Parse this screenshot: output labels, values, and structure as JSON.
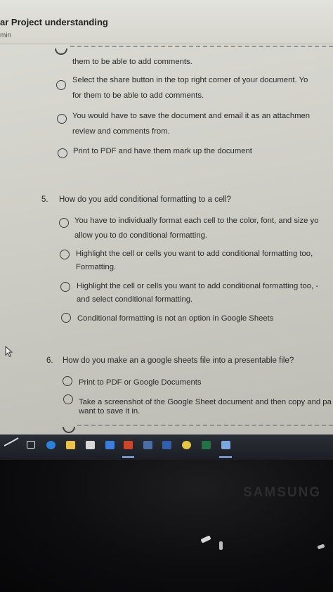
{
  "header": {
    "title": "ar Project understanding",
    "time": "min"
  },
  "question4": {
    "options": [
      {
        "line1": "them to be able to add comments.",
        "line2": ""
      },
      {
        "line1": "Select the share button in the top right corner of your document. Yo",
        "line2": "for them to be able to add comments."
      },
      {
        "line1": "You would have to save the document and email it as an attachmen",
        "line2": "review and comments from."
      },
      {
        "line1": "Print to PDF and have them mark up the document",
        "line2": ""
      }
    ]
  },
  "question5": {
    "number": "5.",
    "text": "How do you add conditional formatting to a cell?",
    "options": [
      {
        "line1": "You have to individually format each cell to the color, font, and size yo",
        "line2": "allow you to do conditional formatting."
      },
      {
        "line1": "Highlight the cell or cells you want to add conditional formatting too,",
        "line2": "Formatting."
      },
      {
        "line1": "Highlight the cell or cells you want to add conditional formatting too, -",
        "line2": "and select conditional formatting."
      },
      {
        "line1": "Conditional formatting is not an option in Google Sheets",
        "line2": ""
      }
    ]
  },
  "question6": {
    "number": "6.",
    "text": "How do you make an a google sheets file into a presentable file?",
    "options": [
      {
        "line1": "Print to PDF or Google Documents",
        "line2": ""
      },
      {
        "line1": "Take a screenshot of the Google Sheet document and then copy and pa",
        "line2": "want to save it in."
      }
    ]
  },
  "taskbar": {
    "icons": [
      "task-view-icon",
      "edge-browser-icon",
      "file-explorer-icon",
      "store-icon",
      "mail-icon",
      "powerpoint-icon",
      "app-icon",
      "word-icon",
      "chrome-icon",
      "excel-icon",
      "active-app-icon"
    ],
    "accent": "#8fb3ff"
  },
  "monitor": {
    "brand": "SAMSUNG"
  }
}
